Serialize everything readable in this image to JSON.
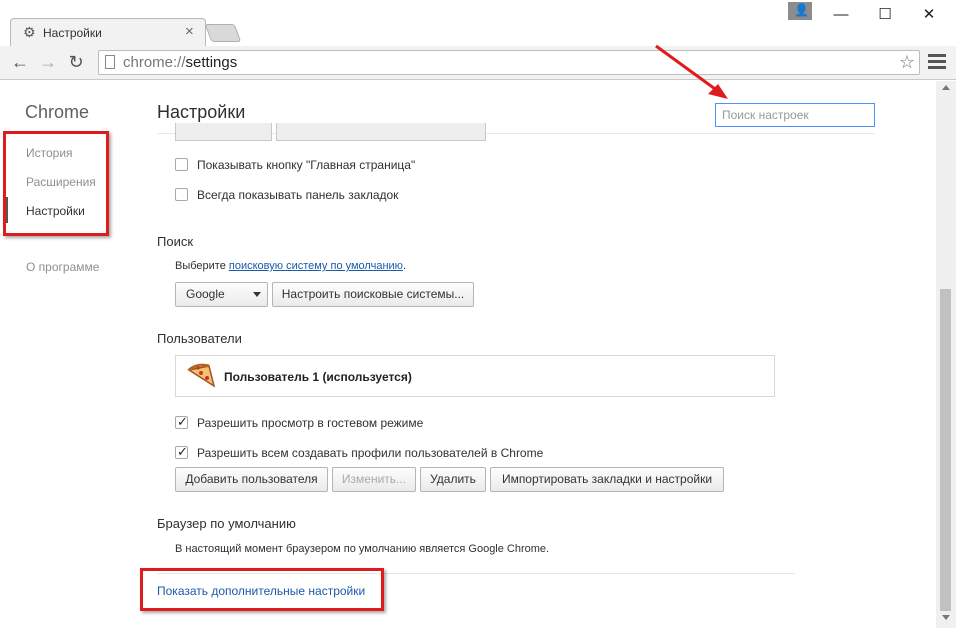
{
  "window": {
    "tab_title": "Настройки",
    "tab_close": "×",
    "min_glyph": "—",
    "max_glyph": "☐",
    "close_glyph": "✕"
  },
  "toolbar": {
    "url_scheme": "chrome://",
    "url_path": "settings",
    "back_glyph": "←",
    "forward_glyph": "→",
    "reload_glyph": "↻",
    "star_glyph": "☆"
  },
  "sidebar": {
    "brand": "Chrome",
    "items": [
      {
        "label": "История"
      },
      {
        "label": "Расширения"
      },
      {
        "label": "Настройки"
      },
      {
        "label": "О программе"
      }
    ]
  },
  "header": {
    "title": "Настройки",
    "search_placeholder": "Поиск настроек"
  },
  "appearance": {
    "show_home_button": {
      "label": "Показывать кнопку \"Главная страница\"",
      "checked": false
    },
    "show_bookmarks_bar": {
      "label": "Всегда показывать панель закладок",
      "checked": false
    }
  },
  "search_section": {
    "heading": "Поиск",
    "text_before": "Выберите ",
    "link": "поисковую систему по умолчанию",
    "text_after": ".",
    "engine": "Google",
    "manage_button": "Настроить поисковые системы..."
  },
  "users": {
    "heading": "Пользователи",
    "current_user": "Пользователь 1 (используется)",
    "guest_browsing": {
      "label": "Разрешить просмотр в гостевом режиме",
      "checked": true
    },
    "anyone_add": {
      "label": "Разрешить всем создавать профили пользователей в Chrome",
      "checked": true
    },
    "buttons": {
      "add": "Добавить пользователя",
      "edit": "Изменить...",
      "delete": "Удалить",
      "import": "Импортировать закладки и настройки"
    }
  },
  "default_browser": {
    "heading": "Браузер по умолчанию",
    "status": "В настоящий момент браузером по умолчанию является Google Chrome."
  },
  "advanced_link": "Показать дополнительные настройки",
  "colors": {
    "annotation_red": "#e01b1b",
    "link_blue": "#1a5aa8",
    "focus_blue": "#4d90fe"
  },
  "icons": {
    "tab": "gear-icon",
    "profile": "person-icon",
    "omnibox": "page-icon",
    "star": "star-icon",
    "menu": "hamburger-menu-icon",
    "user": "pizza-avatar-icon"
  }
}
